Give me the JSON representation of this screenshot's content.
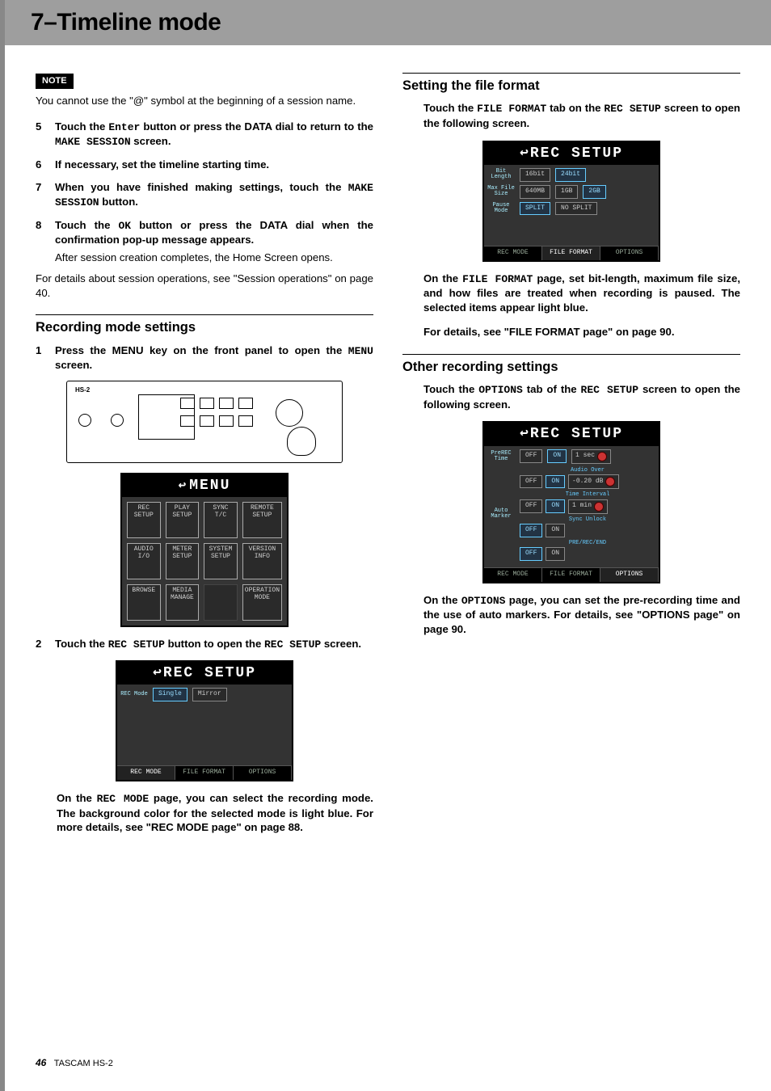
{
  "header": {
    "title": "7–Timeline mode"
  },
  "left": {
    "noteLabel": "NOTE",
    "noteText": "You cannot use the \"@\" symbol at the beginning of a session name.",
    "steps": [
      {
        "n": "5",
        "bold_pre": "Touch the ",
        "mono": "Enter",
        "bold_mid": " button or press the DATA dial to return to the ",
        "mono2": "MAKE SESSION",
        "bold_post": " screen."
      },
      {
        "n": "6",
        "bold_pre": "If necessary, set the timeline starting time."
      },
      {
        "n": "7",
        "bold_pre": "When you have finished making settings, touch the ",
        "mono": "MAKE SESSION",
        "bold_post": " button."
      },
      {
        "n": "8",
        "bold_pre": "Touch the ",
        "mono": "OK",
        "bold_mid": " button or press the DATA dial when the confirmation pop-up message appears.",
        "plain": "After session creation completes, the Home Screen opens."
      }
    ],
    "afterSteps": "For details about session operations, see \"Session operations\" on page 40.",
    "h2a": "Recording mode settings",
    "step1_pre": "Press the MENU key on the front panel to open the ",
    "step1_mono": "MENU",
    "step1_post": " screen.",
    "deviceLabel": "HS-2",
    "menuTitle": "MENU",
    "menuCells": [
      "REC SETUP",
      "PLAY SETUP",
      "SYNC T/C",
      "REMOTE SETUP",
      "AUDIO I/O",
      "METER SETUP",
      "SYSTEM SETUP",
      "VERSION INFO",
      "BROWSE",
      "MEDIA MANAGE",
      "",
      "OPERATION MODE"
    ],
    "step2_pre": "Touch the ",
    "step2_mono": "REC SETUP",
    "step2_mid": " button to open the ",
    "step2_mono2": "REC SETUP",
    "step2_post": " screen.",
    "rec1": {
      "title": "REC SETUP",
      "rowLabel": "REC Mode",
      "btnA": "Single",
      "btnB": "Mirror",
      "tabs": [
        "REC MODE",
        "FILE FORMAT",
        "OPTIONS"
      ]
    },
    "para1_pre": "On the ",
    "para1_mono": "REC MODE",
    "para1_post": " page, you can select the recording mode. The background color for the selected mode is light blue. For more details, see \"REC MODE page\" on page 88."
  },
  "right": {
    "h2a": "Setting the file format",
    "p1_pre": "Touch the ",
    "p1_mono": "FILE FORMAT",
    "p1_mid": " tab on the ",
    "p1_mono2": "REC SETUP",
    "p1_post": " screen to open the following screen.",
    "rec2": {
      "title": "REC SETUP",
      "rows": [
        {
          "label": "Bit Length",
          "a": "16bit",
          "b": "24bit",
          "sel": "b"
        },
        {
          "label": "Max File Size",
          "a": "640MB",
          "b": "1GB",
          "c": "2GB",
          "sel": "c"
        },
        {
          "label": "Pause Mode",
          "a": "SPLIT",
          "b": "NO SPLIT",
          "sel": "a"
        }
      ],
      "tabs": [
        "REC MODE",
        "FILE FORMAT",
        "OPTIONS"
      ]
    },
    "p2_pre": "On the ",
    "p2_mono": "FILE FORMAT",
    "p2_post": " page, set bit-length, maximum file size, and how files are treated when recording is paused. The selected items appear light blue.",
    "p3": "For details, see \"FILE FORMAT page\" on page 90.",
    "h2b": "Other recording settings",
    "p4_pre": "Touch the ",
    "p4_mono": "OPTIONS",
    "p4_mid": " tab of the ",
    "p4_mono2": "REC SETUP",
    "p4_post": " screen to open the following screen.",
    "rec3": {
      "title": "REC SETUP",
      "rows": [
        {
          "label": "PreREC Time",
          "a": "OFF",
          "b": "ON",
          "val": "1 sec"
        },
        {
          "label": "Auto Marker",
          "sub": "Audio Over",
          "a": "OFF",
          "b": "ON",
          "val": "-0.20 dB"
        },
        {
          "label": "",
          "sub": "Time Interval",
          "a": "OFF",
          "b": "ON",
          "val": "1 min"
        },
        {
          "label": "",
          "sub": "Sync Unlock",
          "a": "OFF",
          "b": "ON"
        },
        {
          "label": "",
          "sub": "PRE/REC/END",
          "a": "OFF",
          "b": "ON"
        }
      ],
      "tabs": [
        "REC MODE",
        "FILE FORMAT",
        "OPTIONS"
      ]
    },
    "p5_pre": "On the ",
    "p5_mono": "OPTIONS",
    "p5_post": " page, you can set the pre-recording time and the use of auto markers. For details, see \"OPTIONS page\" on page 90."
  },
  "footer": {
    "page": "46",
    "model": "TASCAM HS-2"
  }
}
